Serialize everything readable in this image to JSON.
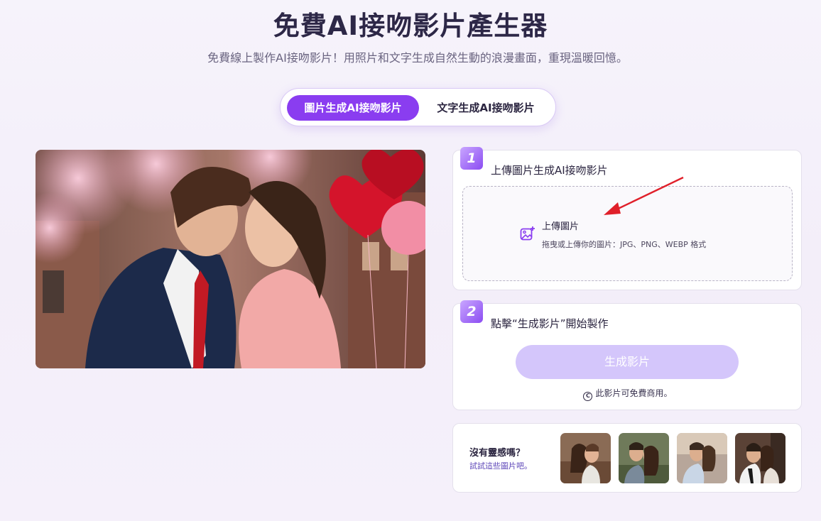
{
  "header": {
    "title": "免費AI接吻影片產生器",
    "subtitle": "免費線上製作AI接吻影片！用照片和文字生成自然生動的浪漫畫面，重現溫暖回憶。"
  },
  "tabs": [
    {
      "label": "圖片生成AI接吻影片",
      "active": true
    },
    {
      "label": "文字生成AI接吻影片",
      "active": false
    }
  ],
  "step1": {
    "number": "1",
    "title": "上傳圖片生成AI接吻影片",
    "upload_label": "上傳圖片",
    "upload_hint": "拖曳或上傳你的圖片：JPG、PNG、WEBP 格式",
    "icon": "image-plus-icon"
  },
  "step2": {
    "number": "2",
    "title": "點擊“生成影片”開始製作",
    "button_label": "生成影片",
    "note": "此影片可免費商用。"
  },
  "inspiration": {
    "title": "沒有靈感嗎？",
    "subtitle": "試試這些圖片吧。"
  },
  "colors": {
    "accent": "#8a3df0",
    "button_disabled": "#d4c6fb",
    "arrow": "#e0202a"
  }
}
